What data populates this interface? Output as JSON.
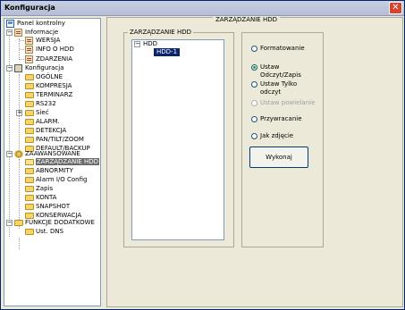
{
  "window": {
    "title": "Konfiguracja"
  },
  "tree": {
    "root": "Panel kontrolny",
    "informacje": {
      "label": "Informacje",
      "items": [
        "WERSJA",
        "INFO O HDD",
        "ZDARZENIA"
      ]
    },
    "konfiguracja": {
      "label": "Konfiguracja",
      "items": [
        "OGÓLNE",
        "KOMPRESJA",
        "TERMINARZ",
        "RS232",
        "Sieć",
        "ALARM.",
        "DETEKCJA",
        "PAN/TILT/ZOOM",
        "DEFAULT/BACKUP"
      ]
    },
    "zaawansowane": {
      "label": "ZAAWANSOWANE",
      "items": [
        "ZARZĄDZANIE HDD",
        "ABNORMITY",
        "Alarm I/O Config",
        "Zapis",
        "KONTA",
        "SNAPSHOT",
        "KONSERWACJA"
      ]
    },
    "funkcje": {
      "label": "FUNKCJE DODATKOWE",
      "items": [
        "Ust. DNS"
      ]
    }
  },
  "main": {
    "title": "ZARZĄDZANIE HDD",
    "hdd_group": {
      "title": "ZARZĄDZANIE HDD",
      "root": "HDD",
      "disk": "HDD-1"
    },
    "options": [
      {
        "label": "Formatowanie",
        "checked": false,
        "disabled": false
      },
      {
        "label": "Ustaw Odczyt/Zapis",
        "checked": true,
        "disabled": false
      },
      {
        "label": "Ustaw Tylko odczyt",
        "checked": false,
        "disabled": false
      },
      {
        "label": "Ustaw powielanie",
        "checked": false,
        "disabled": true
      },
      {
        "label": "Przywracanie",
        "checked": false,
        "disabled": false
      },
      {
        "label": "Jak zdjęcie",
        "checked": false,
        "disabled": false
      }
    ],
    "execute_label": "Wykonaj"
  }
}
